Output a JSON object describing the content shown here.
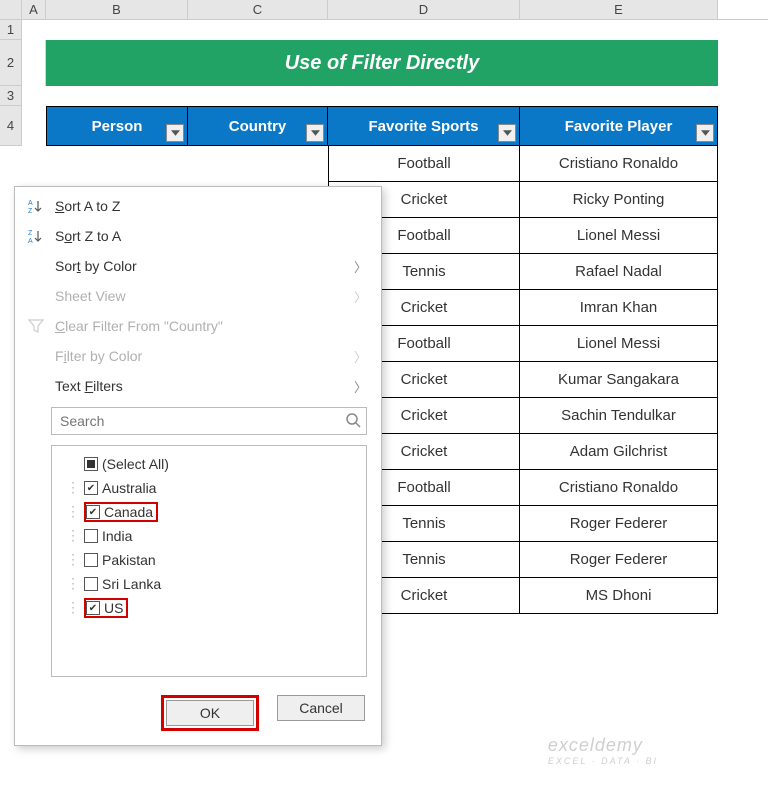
{
  "columns": {
    "A": "A",
    "B": "B",
    "C": "C",
    "D": "D",
    "E": "E"
  },
  "rows": {
    "r1": "1",
    "r2": "2",
    "r3": "3",
    "r4": "4"
  },
  "title": "Use of Filter Directly",
  "headers": {
    "person": "Person",
    "country": "Country",
    "sports": "Favorite Sports",
    "player": "Favorite Player"
  },
  "data_rows": [
    {
      "sports": "Football",
      "player": "Cristiano Ronaldo"
    },
    {
      "sports": "Cricket",
      "player": "Ricky Ponting"
    },
    {
      "sports": "Football",
      "player": "Lionel Messi"
    },
    {
      "sports": "Tennis",
      "player": "Rafael Nadal"
    },
    {
      "sports": "Cricket",
      "player": "Imran Khan"
    },
    {
      "sports": "Football",
      "player": "Lionel Messi"
    },
    {
      "sports": "Cricket",
      "player": "Kumar Sangakara"
    },
    {
      "sports": "Cricket",
      "player": "Sachin Tendulkar"
    },
    {
      "sports": "Cricket",
      "player": "Adam Gilchrist"
    },
    {
      "sports": "Football",
      "player": "Cristiano Ronaldo"
    },
    {
      "sports": "Tennis",
      "player": "Roger Federer"
    },
    {
      "sports": "Tennis",
      "player": "Roger Federer"
    },
    {
      "sports": "Cricket",
      "player": "MS Dhoni"
    }
  ],
  "dropdown": {
    "sort_az": "Sort A to Z",
    "sort_za": "Sort Z to A",
    "sort_color": "Sort by Color",
    "sheet_view": "Sheet View",
    "clear_filter": "Clear Filter From \"Country\"",
    "filter_color": "Filter by Color",
    "text_filters": "Text Filters",
    "search_placeholder": "Search",
    "items": {
      "select_all": "(Select All)",
      "australia": "Australia",
      "canada": "Canada",
      "india": "India",
      "pakistan": "Pakistan",
      "srilanka": "Sri Lanka",
      "us": "US"
    },
    "ok": "OK",
    "cancel": "Cancel"
  },
  "watermark": {
    "line1": "exceldemy",
    "line2": "EXCEL · DATA · BI"
  }
}
